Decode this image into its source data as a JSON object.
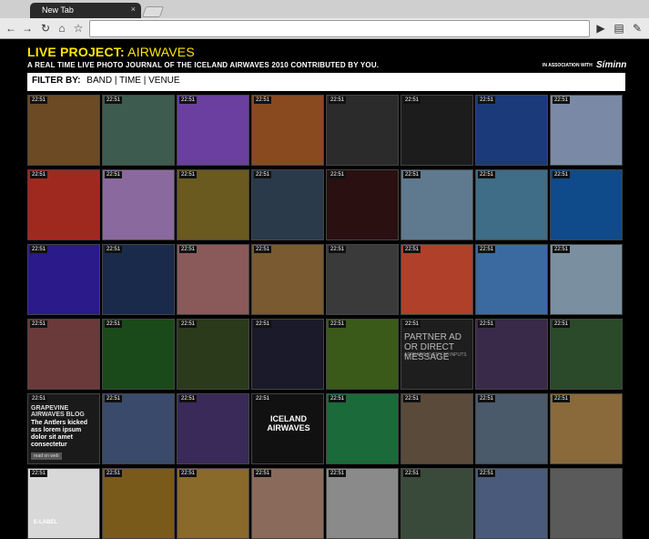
{
  "browser": {
    "tab_title": "New Tab",
    "tab_close": "×"
  },
  "header": {
    "title_prefix": "LIVE PROJECT:",
    "title_rest": " AIRWAVES",
    "subtitle": "A REAL TIME LIVE PHOTO JOURNAL OF THE ICELAND AIRWAVES 2010 CONTRIBUTED BY YOU.",
    "assoc": "IN ASSOCIATION WITH",
    "brand": "Síminn"
  },
  "filter": {
    "label": "FILTER BY:",
    "options": [
      "BAND",
      "TIME",
      "VENUE"
    ],
    "sep": " | "
  },
  "timestamp": "22:51",
  "ad": {
    "line1": "PARTNER AD",
    "line2": "OR DIRECT MESSAGE",
    "sub": "APPEARS EVERY 50 INPUTS"
  },
  "blog": {
    "head": "GRAPEVINE AIRWAVES BLOG",
    "body": "The Antlers kicked ass lorem ipsum dolor sit amet consectetur",
    "button": "read on web"
  },
  "logo": {
    "line1": "ICELAND",
    "line2": "AIRWAVES"
  },
  "elabel": "E-LABEL",
  "colors": {
    "accent": "#ffe600",
    "photos": [
      [
        "#6b4a24",
        "#3d5c4f",
        "#6a3fa0",
        "#8a4a20",
        "#2b2b2b",
        "#1c1c1c",
        "#1b3a7a",
        "#7a8aa6"
      ],
      [
        "#a0291f",
        "#8a6a9e",
        "#6a5a20",
        "#2a3a4a",
        "#2a1010",
        "#5f7a8f",
        "#3f6c86",
        "#0f4a8a"
      ],
      [
        "#2a1a8a",
        "#1a2a4a",
        "#8a5a5a",
        "#7a5a30",
        "#3a3a3a",
        "#b0402a",
        "#3a6aa0",
        "#7a90a0"
      ],
      [
        "#6a3a3a",
        "#1a4a1a",
        "#2a3a1a",
        "#1a1a2a",
        "#3a5a1a",
        "#1e1e1e",
        "#3a2a4a",
        "#2a4a2a"
      ],
      [
        "#1a1a1a",
        "#3a4a6a",
        "#3a2a5a",
        "#111111",
        "#1a6a3a",
        "#5a4a3a",
        "#4a5a6a",
        "#8a6a3a"
      ],
      [
        "#d8d8d8",
        "#7a5a1a",
        "#8a6a2a",
        "#8a6a5a",
        "#8a8a8a",
        "#3a4a3a",
        "#4a5a7a",
        "#5a5a5a"
      ]
    ]
  }
}
